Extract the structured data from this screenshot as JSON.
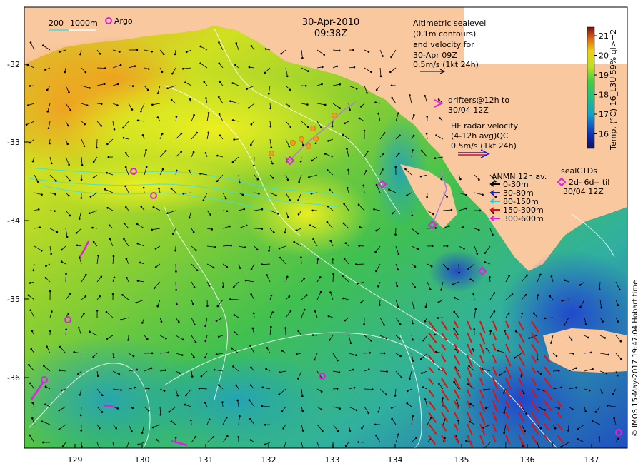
{
  "header": {
    "date": "30-Apr-2010",
    "time": "09:38Z"
  },
  "scale_bar": {
    "label_200": "200",
    "label_1000": "1000m",
    "argo_label": "Argo"
  },
  "altimetry": {
    "line1": "Altimetric sealevel",
    "line2": "(0.1m contours)",
    "line3": "and velocity for",
    "line4": "30-Apr 09Z",
    "line5": "0.5m/s (1kt 24h)"
  },
  "drifters": {
    "line1": "drifters@12h to",
    "line2": "30/04 12Z"
  },
  "hf_radar": {
    "line1": "HF radar velocity",
    "line2": "(4-12h avg)QC",
    "line3": "0.5m/s (1kt 24h)"
  },
  "anmn": {
    "title": "ANMN 12h av.",
    "items": [
      {
        "label": "0-30m",
        "color": "#000000"
      },
      {
        "label": "30-80m",
        "color": "#1020e0"
      },
      {
        "label": "80-150m",
        "color": "#20d0d0"
      },
      {
        "label": "150-300m",
        "color": "#e01010"
      },
      {
        "label": "300-600m",
        "color": "#e020e0"
      }
    ]
  },
  "seal": {
    "title": "sealCTDs",
    "line2": "2d- 6d-- til",
    "line3": "30/04 12Z"
  },
  "colorbar": {
    "title": "Temp. (°C) 16_L3U 59% ql>=2",
    "ticks": [
      "21",
      "20",
      "19",
      "18",
      "17",
      "16"
    ]
  },
  "axes": {
    "x_ticks": [
      "129",
      "130",
      "131",
      "132",
      "133",
      "134",
      "135",
      "136",
      "137"
    ],
    "y_ticks": [
      "-32",
      "-33",
      "-34",
      "-35",
      "-36"
    ]
  },
  "credit": "© IMOS 15-May-2017 19:47:04 Hobart time",
  "colors": {
    "land": "#f9c89f",
    "warm": "#f0b020",
    "yellow": "#f0f020",
    "green": "#40c040",
    "teal": "#30b0a0",
    "blue": "#2030c0"
  }
}
